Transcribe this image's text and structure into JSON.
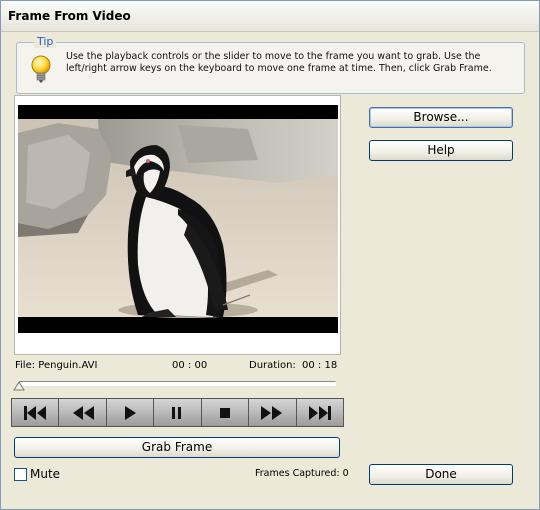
{
  "window": {
    "title": "Frame From Video"
  },
  "tip": {
    "label": "Tip",
    "text": "Use the playback controls or the slider to move to the frame you want to grab. Use the left/right arrow keys on the keyboard to move one frame at time. Then, click Grab Frame."
  },
  "file": {
    "label": "File:",
    "name": "Penguin.AVI",
    "position": "00 : 00",
    "duration_label": "Duration:",
    "duration": "00 : 18"
  },
  "slider": {
    "position_fraction": 0.0
  },
  "transport": {
    "buttons": [
      "skip-to-start-icon",
      "rewind-icon",
      "play-icon",
      "pause-icon",
      "stop-icon",
      "fast-forward-icon",
      "skip-to-end-icon"
    ]
  },
  "buttons": {
    "browse": "Browse...",
    "help": "Help",
    "grab_frame": "Grab Frame",
    "done": "Done"
  },
  "mute": {
    "label": "Mute",
    "checked": false
  },
  "frames_captured": {
    "label": "Frames Captured:",
    "value": "0"
  },
  "colors": {
    "accent": "#2d5cc8",
    "button_border": "#003c74"
  }
}
